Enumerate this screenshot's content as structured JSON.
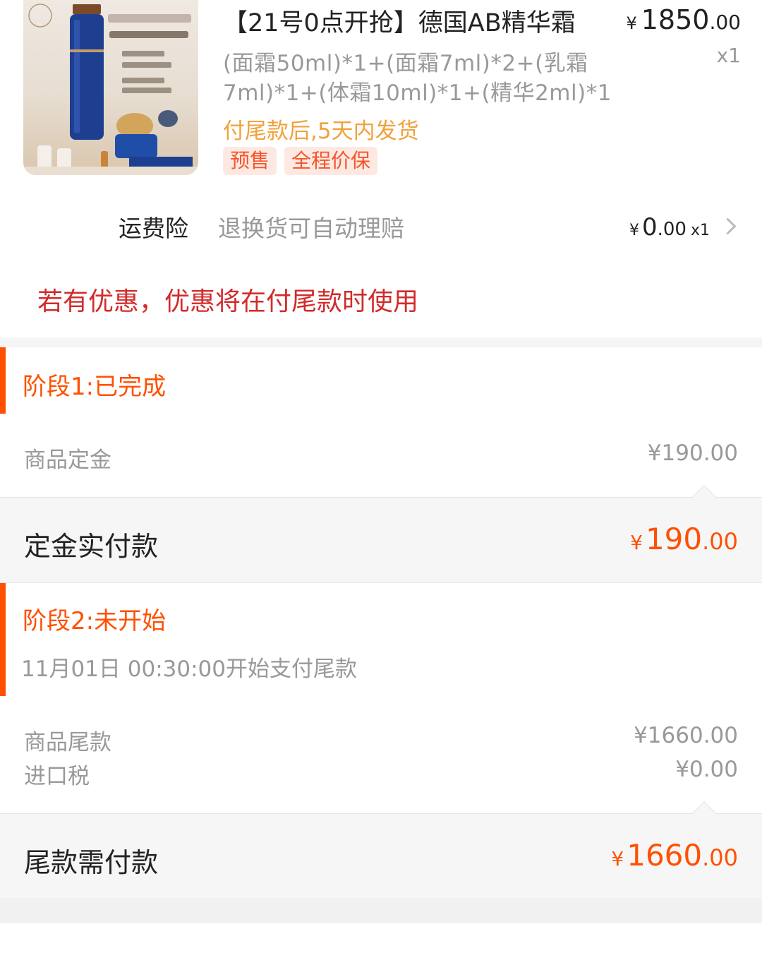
{
  "product": {
    "title": "【21号0点开抢】德国AB精华霜",
    "price_symbol": "¥",
    "price_int": "1850",
    "price_dec": ".00",
    "quantity": "x1",
    "spec_line1": "(面霜50ml)*1+(面霜7ml)*2+(乳霜",
    "spec_line2": "7ml)*1+(体霜10ml)*1+(精华2ml)*1",
    "shipping_note": "付尾款后,5天内发货",
    "tags": [
      "预售",
      "全程价保"
    ]
  },
  "insurance": {
    "label": "运费险",
    "description": "退换货可自动理赔",
    "price_symbol": "¥",
    "price_int": "0",
    "price_dec": ".00",
    "quantity": "x1"
  },
  "notice": "若有优惠，优惠将在付尾款时使用",
  "stage1": {
    "title": "阶段1:已完成",
    "deposit_label": "商品定金",
    "deposit_value": "¥190.00",
    "paid_label": "定金实付款",
    "paid_symbol": "¥",
    "paid_int": "190",
    "paid_dec": ".00"
  },
  "stage2": {
    "title": "阶段2:未开始",
    "start_time": "11月01日 00:30:00开始支付尾款",
    "balance_label": "商品尾款",
    "balance_value": "¥1660.00",
    "tax_label": "进口税",
    "tax_value": "¥0.00",
    "due_label": "尾款需付款",
    "due_symbol": "¥",
    "due_int": "1660",
    "due_dec": ".00"
  },
  "colors": {
    "accent": "#ff5000",
    "notice_red": "#d22b2b",
    "shipping_orange": "#f0a23c",
    "tag_bg": "#fde9e2"
  }
}
